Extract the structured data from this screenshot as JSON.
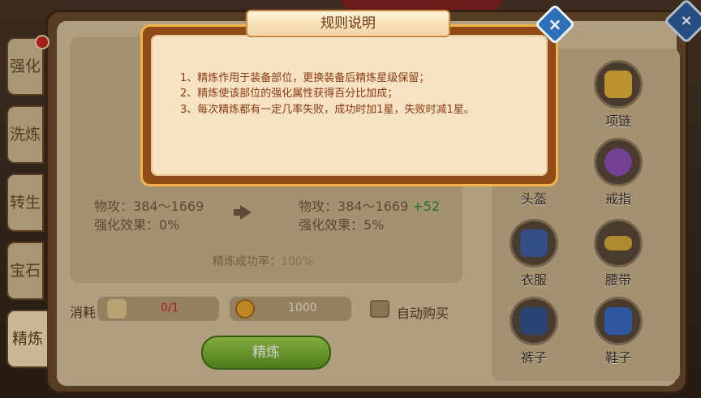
{
  "tabs": [
    "强化",
    "洗炼",
    "转生",
    "宝石",
    "精炼"
  ],
  "attributes": {
    "current_attack_label": "物攻：",
    "current_attack_value": "384～1669",
    "current_effect_label": "强化效果：",
    "current_effect_value": "0%",
    "next_attack_label": "物攻：",
    "next_attack_value": "384～1669",
    "next_attack_bonus": "+52",
    "next_effect_label": "强化效果：",
    "next_effect_value": "5%",
    "success_rate_label": "精炼成功率：",
    "success_rate_value": "100%"
  },
  "cost": {
    "label": "消耗",
    "material_amount": "0/1",
    "gold_amount": "1000",
    "auto_buy_label": "自动购买"
  },
  "refine_button_label": "精炼",
  "equipment": [
    "头盔",
    "项链",
    "戒指",
    "衣服",
    "腰带",
    "裤子",
    "鞋子"
  ],
  "dialog": {
    "title": "规则说明",
    "rules": [
      "1、精炼作用于装备部位，更换装备后精炼星级保留；",
      "2、精炼使该部位的强化属性获得百分比加成；",
      "3、每次精炼都有一定几率失败，成功时加1星，失败时减1星。"
    ],
    "close_label": "×"
  },
  "colors": {
    "accent_green": "#2b8f2b",
    "cost_red": "#c9271f",
    "dialog_text": "#8a3a14"
  }
}
